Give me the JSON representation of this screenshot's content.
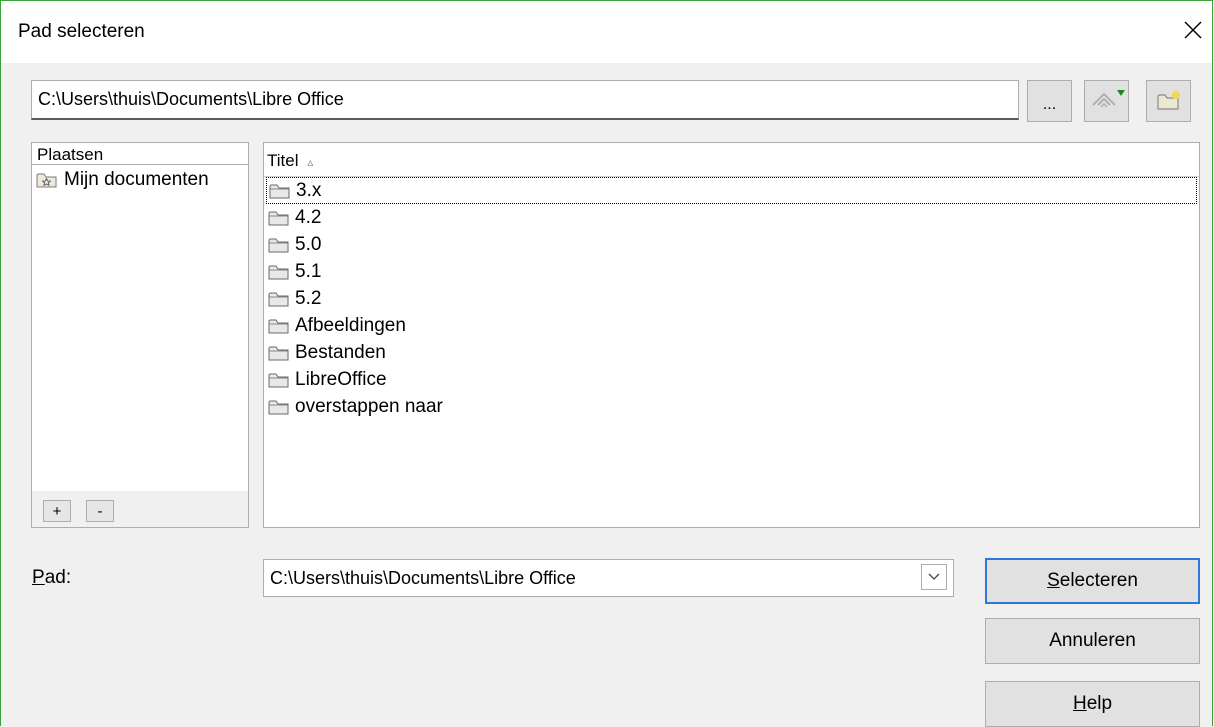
{
  "window": {
    "title": "Pad selecteren"
  },
  "path_field": {
    "value": "C:\\Users\\thuis\\Documents\\Libre Office"
  },
  "toolbar": {
    "browse_label": "..."
  },
  "places": {
    "header": "Plaatsen",
    "items": [
      {
        "label": "Mijn documenten"
      }
    ],
    "add_label": "+",
    "remove_label": "-"
  },
  "files": {
    "column_title": "Titel",
    "sort_indicator": "▵",
    "items": [
      {
        "name": "3.x",
        "selected": true
      },
      {
        "name": "4.2"
      },
      {
        "name": "5.0"
      },
      {
        "name": "5.1"
      },
      {
        "name": "5.2"
      },
      {
        "name": "Afbeeldingen"
      },
      {
        "name": "Bestanden"
      },
      {
        "name": "LibreOffice"
      },
      {
        "name": "overstappen naar"
      }
    ]
  },
  "pad": {
    "label_mnemonic": "P",
    "label_rest": "ad:",
    "value": "C:\\Users\\thuis\\Documents\\Libre Office"
  },
  "buttons": {
    "select_mnemonic": "S",
    "select_rest": "electeren",
    "cancel": "Annuleren",
    "help_mnemonic": "H",
    "help_rest": "elp"
  },
  "colors": {
    "default_button_border": "#2a78d8",
    "window_border": "#3aa33a",
    "arrow_green": "#1a8a1a"
  }
}
